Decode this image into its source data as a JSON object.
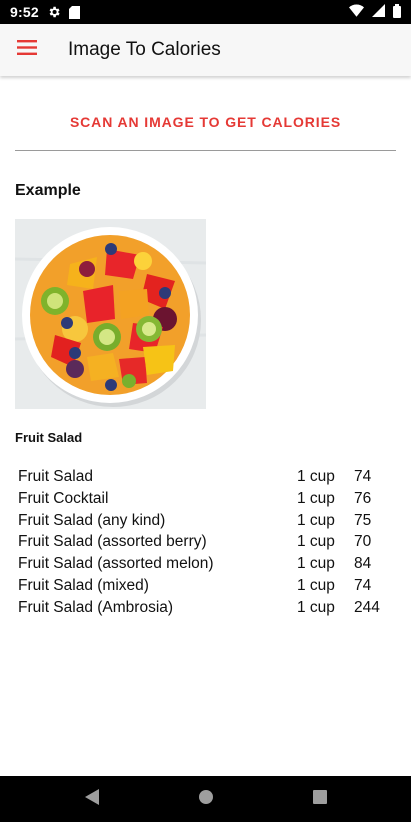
{
  "status_bar": {
    "time": "9:52",
    "icons_left": [
      "gear-icon",
      "sd-card-icon"
    ],
    "icons_right": [
      "wifi-icon",
      "signal-icon",
      "battery-icon"
    ]
  },
  "app_bar": {
    "title": "Image To Calories",
    "menu_icon": "hamburger-menu-icon",
    "accent_color": "#e53935"
  },
  "main": {
    "scan_button_label": "SCAN AN IMAGE TO GET CALORIES",
    "section_title": "Example",
    "example_image": "fruit-salad-bowl-photo",
    "food_label": "Fruit Salad",
    "results": [
      {
        "name": "Fruit Salad",
        "serving": "1 cup",
        "calories": "74"
      },
      {
        "name": "Fruit Cocktail",
        "serving": "1 cup",
        "calories": "76"
      },
      {
        "name": "Fruit Salad (any kind)",
        "serving": "1 cup",
        "calories": "75"
      },
      {
        "name": "Fruit Salad (assorted berry)",
        "serving": "1 cup",
        "calories": "70"
      },
      {
        "name": "Fruit Salad (assorted melon)",
        "serving": "1 cup",
        "calories": "84"
      },
      {
        "name": "Fruit Salad (mixed)",
        "serving": "1 cup",
        "calories": "74"
      },
      {
        "name": "Fruit Salad (Ambrosia)",
        "serving": "1 cup",
        "calories": "244"
      }
    ]
  },
  "nav_bar": {
    "buttons": [
      "back-icon",
      "home-icon",
      "recents-icon"
    ]
  }
}
